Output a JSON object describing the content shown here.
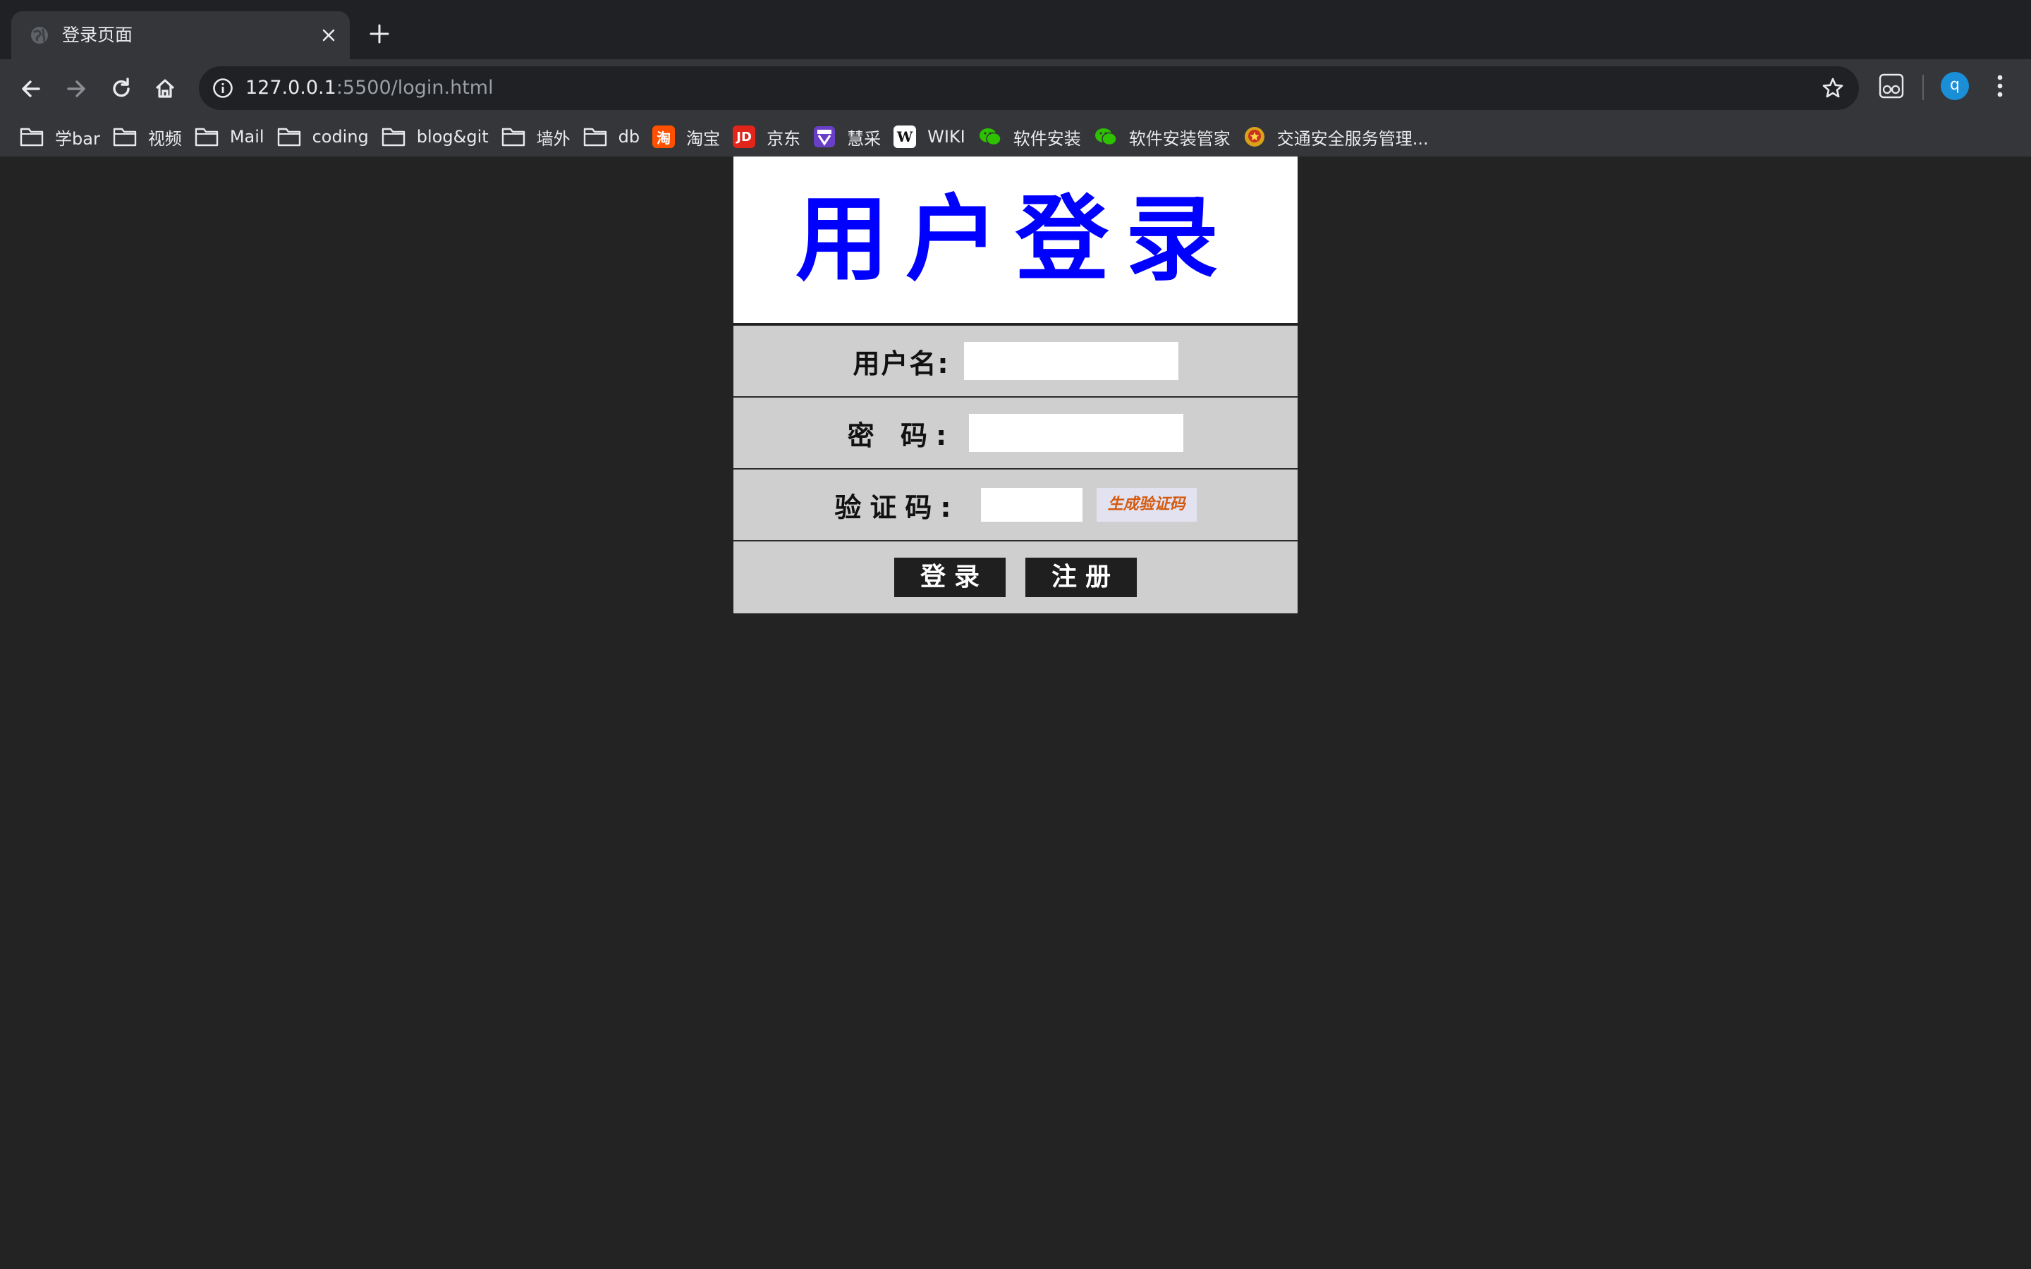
{
  "browser": {
    "tab": {
      "title": "登录页面",
      "favicon": "globe-icon",
      "close_icon": "close-icon"
    },
    "new_tab_icon": "plus-icon",
    "nav": {
      "back_icon": "back-arrow-icon",
      "forward_icon": "forward-arrow-icon",
      "reload_icon": "reload-icon",
      "home_icon": "home-icon"
    },
    "omnibox": {
      "info_icon": "info-icon",
      "host": "127.0.0.1",
      "rest": ":5500/login.html",
      "star_icon": "star-icon"
    },
    "extension_icon": "reader-extension-icon",
    "avatar_letter": "q",
    "menu_icon": "kebab-menu-icon",
    "bookmarks": [
      {
        "label": "学bar",
        "icon": "folder-icon"
      },
      {
        "label": "视频",
        "icon": "folder-icon"
      },
      {
        "label": "Mail",
        "icon": "folder-icon"
      },
      {
        "label": "coding",
        "icon": "folder-icon"
      },
      {
        "label": "blog&git",
        "icon": "folder-icon"
      },
      {
        "label": "墙外",
        "icon": "folder-icon"
      },
      {
        "label": "db",
        "icon": "folder-icon"
      },
      {
        "label": "淘宝",
        "icon": "taobao-icon",
        "badge": "淘",
        "color": "#ff5000"
      },
      {
        "label": "京东",
        "icon": "jd-icon",
        "badge": "JD",
        "color": "#e1251b"
      },
      {
        "label": "慧采",
        "icon": "huicai-icon",
        "badge": "",
        "color": "#6a3fc8"
      },
      {
        "label": "WIKI",
        "icon": "wikipedia-icon",
        "badge": "W",
        "color": "#ffffff"
      },
      {
        "label": "软件安装",
        "icon": "wechat-icon",
        "badge": "",
        "color": "#2dc100"
      },
      {
        "label": "软件安装管家",
        "icon": "wechat-icon",
        "badge": "",
        "color": "#2dc100"
      },
      {
        "label": "交通安全服务管理...",
        "icon": "police-emblem-icon",
        "badge": "",
        "color": "#c8321e"
      }
    ]
  },
  "login": {
    "title": "用户登录",
    "username_label": "用户名:",
    "password_label": "密 码:",
    "captcha_label": "验证码:",
    "captcha_button": "生成验证码",
    "login_button": "登录",
    "register_button": "注册"
  },
  "colors": {
    "page_bg": "#232323",
    "title_blue": "#0000ff",
    "form_bg": "#cfcfcf",
    "captcha_text": "#d45a10"
  }
}
